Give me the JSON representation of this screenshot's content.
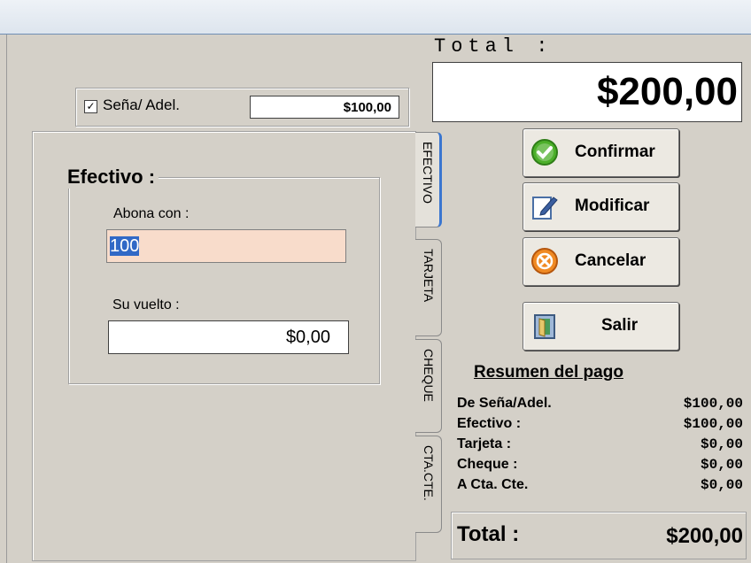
{
  "sena": {
    "checked": "☑",
    "label": "Seña/ Adel.",
    "value": "$100,00"
  },
  "total": {
    "caption": "Total :",
    "value": "$200,00"
  },
  "tabs": [
    {
      "label": "EFECTIVO",
      "active": true
    },
    {
      "label": "TARJETA",
      "active": false
    },
    {
      "label": "CHEQUE",
      "active": false
    },
    {
      "label": "CTA.CTE.",
      "active": false
    }
  ],
  "efectivo": {
    "title": "Efectivo :",
    "abona_label": "Abona con :",
    "abona_value": "100",
    "vuelto_label": "Su vuelto :",
    "vuelto_value": "$0,00"
  },
  "buttons": {
    "confirmar": "Confirmar",
    "modificar": "Modificar",
    "cancelar": "Cancelar",
    "salir": "Salir"
  },
  "resumen": {
    "title": "Resumen del pago",
    "rows": [
      {
        "label": "De Seña/Adel.",
        "value": "$100,00"
      },
      {
        "label": "Efectivo :",
        "value": "$100,00"
      },
      {
        "label": "Tarjeta :",
        "value": "$0,00"
      },
      {
        "label": "Cheque :",
        "value": "$0,00"
      },
      {
        "label": "A Cta. Cte.",
        "value": "$0,00"
      }
    ],
    "total_label": "Total :",
    "total_value": "$200,00"
  },
  "colors": {
    "accent_tab": "#3a76d0",
    "input_highlight": "#f8dccb",
    "selection": "#3169c6"
  },
  "icons": [
    "check-circle-icon",
    "edit-pencil-icon",
    "cancel-circle-icon",
    "exit-door-icon"
  ]
}
